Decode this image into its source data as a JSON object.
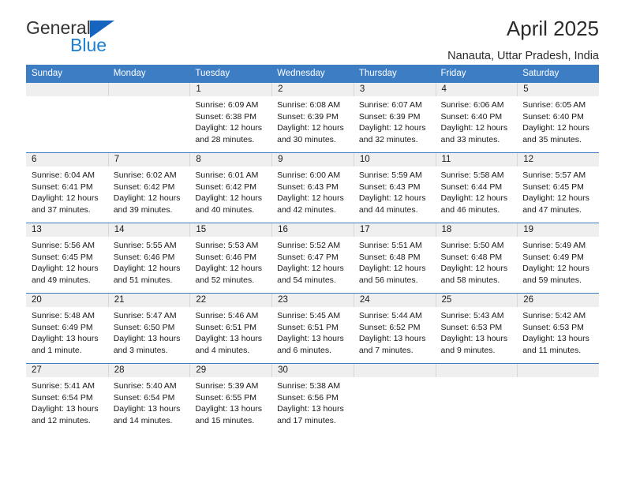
{
  "brand": {
    "name_part1": "General",
    "name_part2": "Blue",
    "logo_icon": "triangle-mark"
  },
  "header": {
    "title": "April 2025",
    "subtitle": "Nanauta, Uttar Pradesh, India"
  },
  "colors": {
    "header_blue": "#3c7dc4",
    "brand_blue": "#1b7fd4",
    "daynum_band": "#efefef",
    "text": "#1a1a1a"
  },
  "weekday_headers": [
    "Sunday",
    "Monday",
    "Tuesday",
    "Wednesday",
    "Thursday",
    "Friday",
    "Saturday"
  ],
  "weeks": [
    [
      {
        "day": "",
        "empty": true,
        "sunrise": "",
        "sunset": "",
        "daylight1": "",
        "daylight2": ""
      },
      {
        "day": "",
        "empty": true,
        "sunrise": "",
        "sunset": "",
        "daylight1": "",
        "daylight2": ""
      },
      {
        "day": "1",
        "sunrise": "Sunrise: 6:09 AM",
        "sunset": "Sunset: 6:38 PM",
        "daylight1": "Daylight: 12 hours",
        "daylight2": "and 28 minutes."
      },
      {
        "day": "2",
        "sunrise": "Sunrise: 6:08 AM",
        "sunset": "Sunset: 6:39 PM",
        "daylight1": "Daylight: 12 hours",
        "daylight2": "and 30 minutes."
      },
      {
        "day": "3",
        "sunrise": "Sunrise: 6:07 AM",
        "sunset": "Sunset: 6:39 PM",
        "daylight1": "Daylight: 12 hours",
        "daylight2": "and 32 minutes."
      },
      {
        "day": "4",
        "sunrise": "Sunrise: 6:06 AM",
        "sunset": "Sunset: 6:40 PM",
        "daylight1": "Daylight: 12 hours",
        "daylight2": "and 33 minutes."
      },
      {
        "day": "5",
        "sunrise": "Sunrise: 6:05 AM",
        "sunset": "Sunset: 6:40 PM",
        "daylight1": "Daylight: 12 hours",
        "daylight2": "and 35 minutes."
      }
    ],
    [
      {
        "day": "6",
        "sunrise": "Sunrise: 6:04 AM",
        "sunset": "Sunset: 6:41 PM",
        "daylight1": "Daylight: 12 hours",
        "daylight2": "and 37 minutes."
      },
      {
        "day": "7",
        "sunrise": "Sunrise: 6:02 AM",
        "sunset": "Sunset: 6:42 PM",
        "daylight1": "Daylight: 12 hours",
        "daylight2": "and 39 minutes."
      },
      {
        "day": "8",
        "sunrise": "Sunrise: 6:01 AM",
        "sunset": "Sunset: 6:42 PM",
        "daylight1": "Daylight: 12 hours",
        "daylight2": "and 40 minutes."
      },
      {
        "day": "9",
        "sunrise": "Sunrise: 6:00 AM",
        "sunset": "Sunset: 6:43 PM",
        "daylight1": "Daylight: 12 hours",
        "daylight2": "and 42 minutes."
      },
      {
        "day": "10",
        "sunrise": "Sunrise: 5:59 AM",
        "sunset": "Sunset: 6:43 PM",
        "daylight1": "Daylight: 12 hours",
        "daylight2": "and 44 minutes."
      },
      {
        "day": "11",
        "sunrise": "Sunrise: 5:58 AM",
        "sunset": "Sunset: 6:44 PM",
        "daylight1": "Daylight: 12 hours",
        "daylight2": "and 46 minutes."
      },
      {
        "day": "12",
        "sunrise": "Sunrise: 5:57 AM",
        "sunset": "Sunset: 6:45 PM",
        "daylight1": "Daylight: 12 hours",
        "daylight2": "and 47 minutes."
      }
    ],
    [
      {
        "day": "13",
        "sunrise": "Sunrise: 5:56 AM",
        "sunset": "Sunset: 6:45 PM",
        "daylight1": "Daylight: 12 hours",
        "daylight2": "and 49 minutes."
      },
      {
        "day": "14",
        "sunrise": "Sunrise: 5:55 AM",
        "sunset": "Sunset: 6:46 PM",
        "daylight1": "Daylight: 12 hours",
        "daylight2": "and 51 minutes."
      },
      {
        "day": "15",
        "sunrise": "Sunrise: 5:53 AM",
        "sunset": "Sunset: 6:46 PM",
        "daylight1": "Daylight: 12 hours",
        "daylight2": "and 52 minutes."
      },
      {
        "day": "16",
        "sunrise": "Sunrise: 5:52 AM",
        "sunset": "Sunset: 6:47 PM",
        "daylight1": "Daylight: 12 hours",
        "daylight2": "and 54 minutes."
      },
      {
        "day": "17",
        "sunrise": "Sunrise: 5:51 AM",
        "sunset": "Sunset: 6:48 PM",
        "daylight1": "Daylight: 12 hours",
        "daylight2": "and 56 minutes."
      },
      {
        "day": "18",
        "sunrise": "Sunrise: 5:50 AM",
        "sunset": "Sunset: 6:48 PM",
        "daylight1": "Daylight: 12 hours",
        "daylight2": "and 58 minutes."
      },
      {
        "day": "19",
        "sunrise": "Sunrise: 5:49 AM",
        "sunset": "Sunset: 6:49 PM",
        "daylight1": "Daylight: 12 hours",
        "daylight2": "and 59 minutes."
      }
    ],
    [
      {
        "day": "20",
        "sunrise": "Sunrise: 5:48 AM",
        "sunset": "Sunset: 6:49 PM",
        "daylight1": "Daylight: 13 hours",
        "daylight2": "and 1 minute."
      },
      {
        "day": "21",
        "sunrise": "Sunrise: 5:47 AM",
        "sunset": "Sunset: 6:50 PM",
        "daylight1": "Daylight: 13 hours",
        "daylight2": "and 3 minutes."
      },
      {
        "day": "22",
        "sunrise": "Sunrise: 5:46 AM",
        "sunset": "Sunset: 6:51 PM",
        "daylight1": "Daylight: 13 hours",
        "daylight2": "and 4 minutes."
      },
      {
        "day": "23",
        "sunrise": "Sunrise: 5:45 AM",
        "sunset": "Sunset: 6:51 PM",
        "daylight1": "Daylight: 13 hours",
        "daylight2": "and 6 minutes."
      },
      {
        "day": "24",
        "sunrise": "Sunrise: 5:44 AM",
        "sunset": "Sunset: 6:52 PM",
        "daylight1": "Daylight: 13 hours",
        "daylight2": "and 7 minutes."
      },
      {
        "day": "25",
        "sunrise": "Sunrise: 5:43 AM",
        "sunset": "Sunset: 6:53 PM",
        "daylight1": "Daylight: 13 hours",
        "daylight2": "and 9 minutes."
      },
      {
        "day": "26",
        "sunrise": "Sunrise: 5:42 AM",
        "sunset": "Sunset: 6:53 PM",
        "daylight1": "Daylight: 13 hours",
        "daylight2": "and 11 minutes."
      }
    ],
    [
      {
        "day": "27",
        "sunrise": "Sunrise: 5:41 AM",
        "sunset": "Sunset: 6:54 PM",
        "daylight1": "Daylight: 13 hours",
        "daylight2": "and 12 minutes."
      },
      {
        "day": "28",
        "sunrise": "Sunrise: 5:40 AM",
        "sunset": "Sunset: 6:54 PM",
        "daylight1": "Daylight: 13 hours",
        "daylight2": "and 14 minutes."
      },
      {
        "day": "29",
        "sunrise": "Sunrise: 5:39 AM",
        "sunset": "Sunset: 6:55 PM",
        "daylight1": "Daylight: 13 hours",
        "daylight2": "and 15 minutes."
      },
      {
        "day": "30",
        "sunrise": "Sunrise: 5:38 AM",
        "sunset": "Sunset: 6:56 PM",
        "daylight1": "Daylight: 13 hours",
        "daylight2": "and 17 minutes."
      },
      {
        "day": "",
        "empty": true,
        "sunrise": "",
        "sunset": "",
        "daylight1": "",
        "daylight2": ""
      },
      {
        "day": "",
        "empty": true,
        "sunrise": "",
        "sunset": "",
        "daylight1": "",
        "daylight2": ""
      },
      {
        "day": "",
        "empty": true,
        "sunrise": "",
        "sunset": "",
        "daylight1": "",
        "daylight2": ""
      }
    ]
  ]
}
